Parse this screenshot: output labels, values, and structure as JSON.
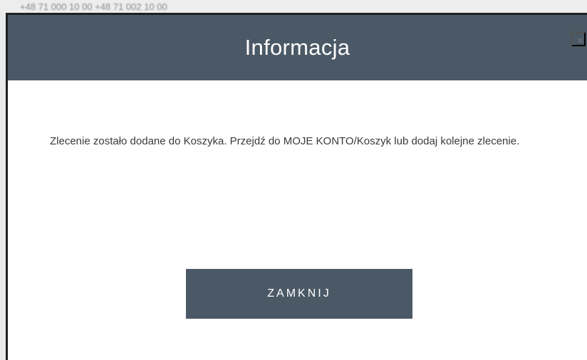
{
  "background": {
    "partial_text": "+48 71 000 10 00  +48 71 002 10 00"
  },
  "dialog": {
    "title": "Informacja",
    "close_icon": "×",
    "message": "Zlecenie zostało dodane do Koszyka. Przejdź do MOJE KONTO/Koszyk lub dodaj kolejne zlecenie.",
    "button_label": "ZAMKNIJ"
  },
  "colors": {
    "header": "#4b5966",
    "button": "#4b5966",
    "text": "#3a3a3a",
    "background": "#ffffff"
  },
  "icons": {
    "close": "close-icon"
  }
}
